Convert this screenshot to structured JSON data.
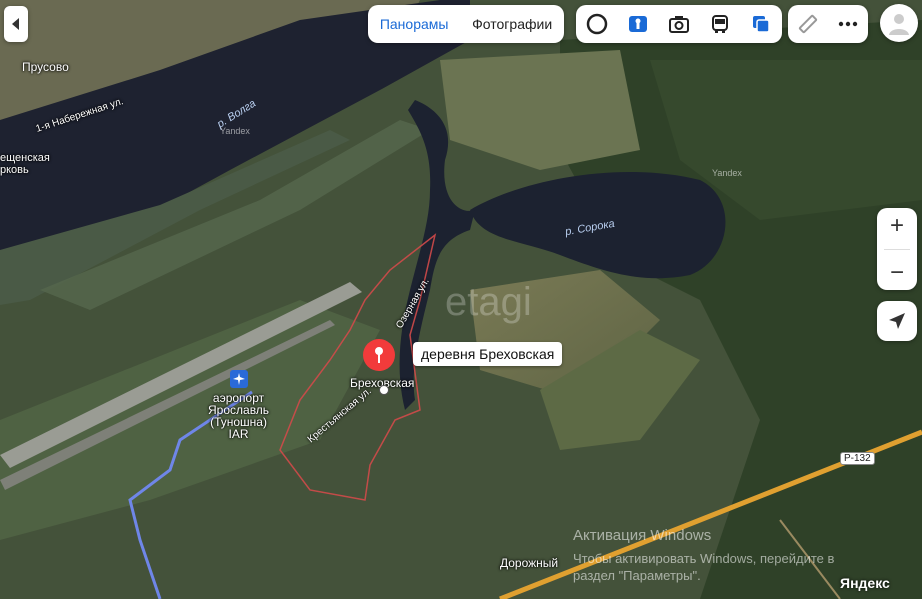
{
  "tabs": {
    "panoramas": "Панорамы",
    "photos": "Фотографии"
  },
  "tools": {
    "layers_icon": "layers-icon",
    "transit_icon": "bus-icon",
    "photo_icon": "camera-icon",
    "panorama_icon": "panorama-person-icon",
    "traffic_icon": "traffic-icon",
    "ruler_icon": "ruler-icon",
    "more_icon": "more-dots-icon"
  },
  "labels": {
    "prusovo": "Прусово",
    "street1": "1-я Набережная ул.",
    "church": "ещенская\nрковь",
    "volga": "р. Волга",
    "soroka": "р. Сорока",
    "brehovskaya": "Бреховская",
    "airport": "аэропорт\nЯрославль\n(Туношна)\nIAR",
    "street_krest": "Крестьянская ул.",
    "street_ozer": "Озерная ул.",
    "dorozhny": "Дорожный",
    "road": "Р-132"
  },
  "yandex_marks": [
    "Yandex",
    "Yandex"
  ],
  "popup": "деревня Бреховская",
  "controls": {
    "zoom_in": "+",
    "zoom_out": "−"
  },
  "watermark": {
    "etagi": "etagi",
    "activate": "Активация Windows",
    "activate_sub": "Чтобы активировать Windows, перейдите в\nраздел \"Параметры\".",
    "logo": "Яндекс"
  }
}
